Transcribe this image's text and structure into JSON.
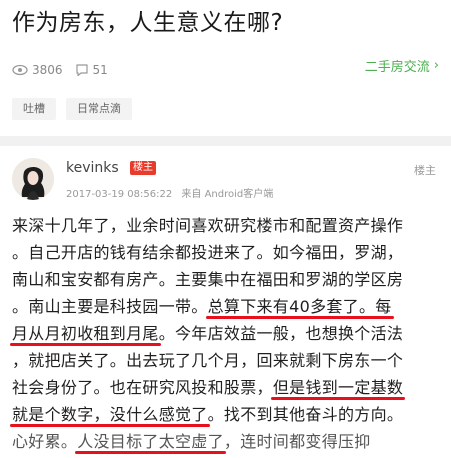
{
  "title": "作为房东，人生意义在哪?",
  "stats": {
    "views": "3806",
    "comments": "51"
  },
  "category": {
    "label": "二手房交流",
    "chevron": "›"
  },
  "tags": [
    "吐槽",
    "日常点滴"
  ],
  "post": {
    "username": "kevinks",
    "badge": "楼主",
    "date": "2017-03-19 08:56:22",
    "source": "来自 Android客户端",
    "floor": "楼主",
    "lines": [
      [
        "来深十几年了，业余时间喜欢研究楼市和配置资产操作"
      ],
      [
        "。自己开店的钱有结余都投进来了。如今福田，罗湖，"
      ],
      [
        "南山和宝安都有房产。主要集中在福田和罗湖的学区房"
      ],
      [
        "。南山主要是科技园一带。",
        "总算下来有40多套了。每"
      ],
      [
        "月从月初收租到月尾",
        "。今年店效益一般，也想换个活法"
      ],
      [
        "，就把店关了。出去玩了几个月，回来就剩下房东一个"
      ],
      [
        "社会身份了。也在研究风投和股票，",
        "但是钱到一定基数"
      ],
      [
        "就是个数字，没什么感觉了",
        "。找不到其他奋斗的方向。"
      ],
      [
        "心好累。",
        "人没目标了太空虚了",
        "，连时间都变得压抑"
      ]
    ]
  },
  "colors": {
    "accent_green": "#4caf50",
    "highlight_red": "#e8101c",
    "badge_red": "#e83b2c"
  },
  "icons": {
    "views": "eye-icon",
    "comments": "comment-icon"
  }
}
